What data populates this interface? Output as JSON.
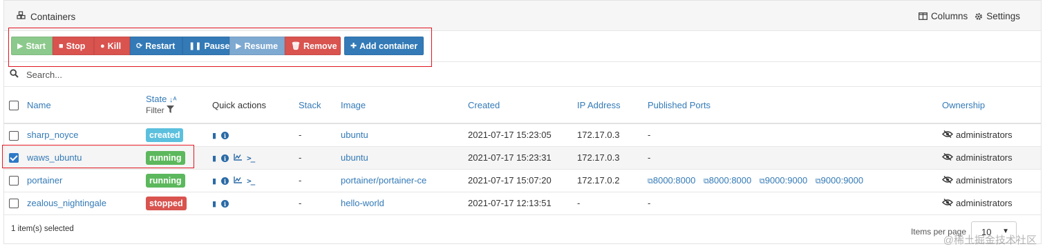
{
  "header": {
    "title": "Containers",
    "columns_label": "Columns",
    "settings_label": "Settings"
  },
  "toolbar": {
    "start": "Start",
    "stop": "Stop",
    "kill": "Kill",
    "restart": "Restart",
    "pause": "Pause",
    "resume": "Resume",
    "remove": "Remove",
    "add_container": "Add container"
  },
  "search": {
    "placeholder": "Search..."
  },
  "table": {
    "headers": {
      "name": "Name",
      "state": "State",
      "filter": "Filter",
      "quick_actions": "Quick actions",
      "stack": "Stack",
      "image": "Image",
      "created": "Created",
      "ip": "IP Address",
      "ports": "Published Ports",
      "ownership": "Ownership"
    },
    "rows": [
      {
        "name": "sharp_noyce",
        "state": "created",
        "stack": "-",
        "image": "ubuntu",
        "created": "2021-07-17 15:23:05",
        "ip": "172.17.0.3",
        "ports_text": "-",
        "ownership": "administrators",
        "selected": false
      },
      {
        "name": "waws_ubuntu",
        "state": "running",
        "stack": "-",
        "image": "ubuntu",
        "created": "2021-07-17 15:23:31",
        "ip": "172.17.0.3",
        "ports_text": "-",
        "ownership": "administrators",
        "selected": true
      },
      {
        "name": "portainer",
        "state": "running",
        "stack": "-",
        "image": "portainer/portainer-ce",
        "created": "2021-07-17 15:07:20",
        "ip": "172.17.0.2",
        "ports": [
          "8000:8000",
          "8000:8000",
          "9000:9000",
          "9000:9000"
        ],
        "ownership": "administrators",
        "selected": false
      },
      {
        "name": "zealous_nightingale",
        "state": "stopped",
        "stack": "-",
        "image": "hello-world",
        "created": "2021-07-17 12:13:51",
        "ip": "-",
        "ports_text": "-",
        "ownership": "administrators",
        "selected": false
      }
    ]
  },
  "footer": {
    "selected_text": "1 item(s) selected",
    "items_per_page_label": "Items per page",
    "items_per_page_value": "10"
  },
  "watermark": "@稀土掘金技术社区",
  "colors": {
    "created": "#5bc0de",
    "running": "#5cb85c",
    "stopped": "#d9534f",
    "accent": "#337ab7",
    "highlight": "#e0141e"
  }
}
